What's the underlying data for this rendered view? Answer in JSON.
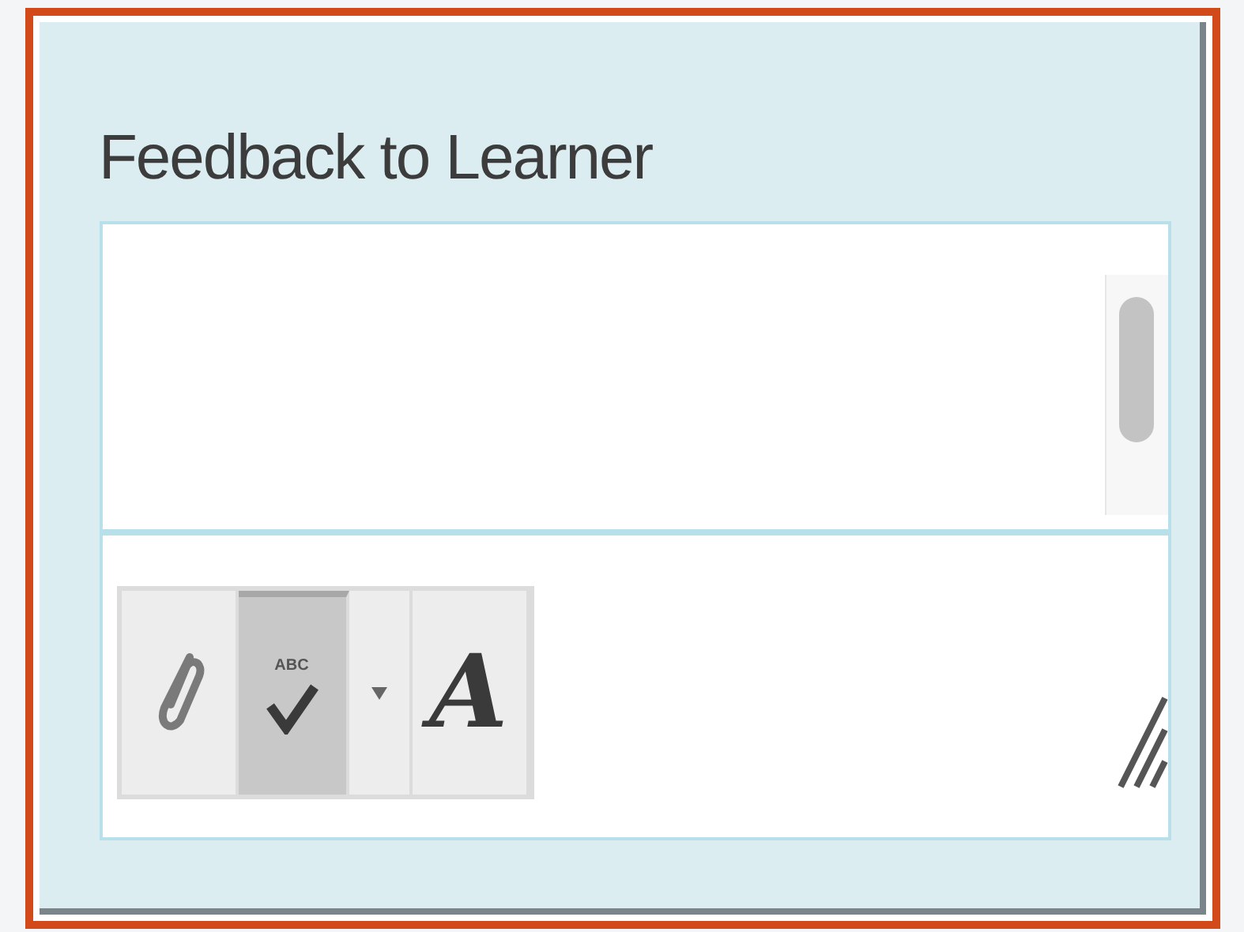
{
  "panel": {
    "title": "Feedback to Learner"
  },
  "toolbar": [
    {
      "kind": "attach",
      "selected": false
    },
    {
      "kind": "spellcheck",
      "label": "ABC",
      "selected": true
    },
    {
      "kind": "dropdown",
      "selected": false
    },
    {
      "kind": "font",
      "label": "A",
      "selected": false
    }
  ]
}
